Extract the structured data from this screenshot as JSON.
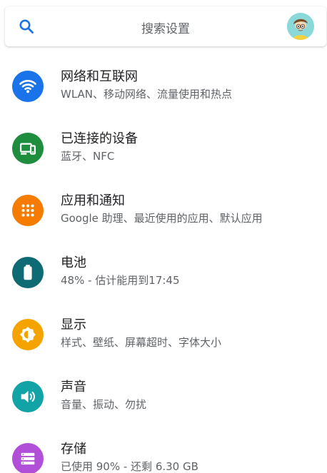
{
  "search": {
    "label": "搜索设置"
  },
  "settings": {
    "items": [
      {
        "title": "网络和互联网",
        "summary": "WLAN、移动网络、流量使用和热点",
        "icon": "wifi-icon",
        "color": "#1a73e8"
      },
      {
        "title": "已连接的设备",
        "summary": "蓝牙、NFC",
        "icon": "devices-icon",
        "color": "#1e8e3e"
      },
      {
        "title": "应用和通知",
        "summary": "Google 助理、最近使用的应用、默认应用",
        "icon": "apps-icon",
        "color": "#f57c00"
      },
      {
        "title": "电池",
        "summary": "48% - 估计能用到17:45",
        "icon": "battery-icon",
        "color": "#0f6b73"
      },
      {
        "title": "显示",
        "summary": "样式、壁纸、屏幕超时、字体大小",
        "icon": "brightness-icon",
        "color": "#f4a300"
      },
      {
        "title": "声音",
        "summary": "音量、振动、勿扰",
        "icon": "sound-icon",
        "color": "#12a3a6"
      },
      {
        "title": "存储",
        "summary": "已使用 90% - 还剩 6.30 GB",
        "icon": "storage-icon",
        "color": "#b14fd8"
      }
    ]
  }
}
